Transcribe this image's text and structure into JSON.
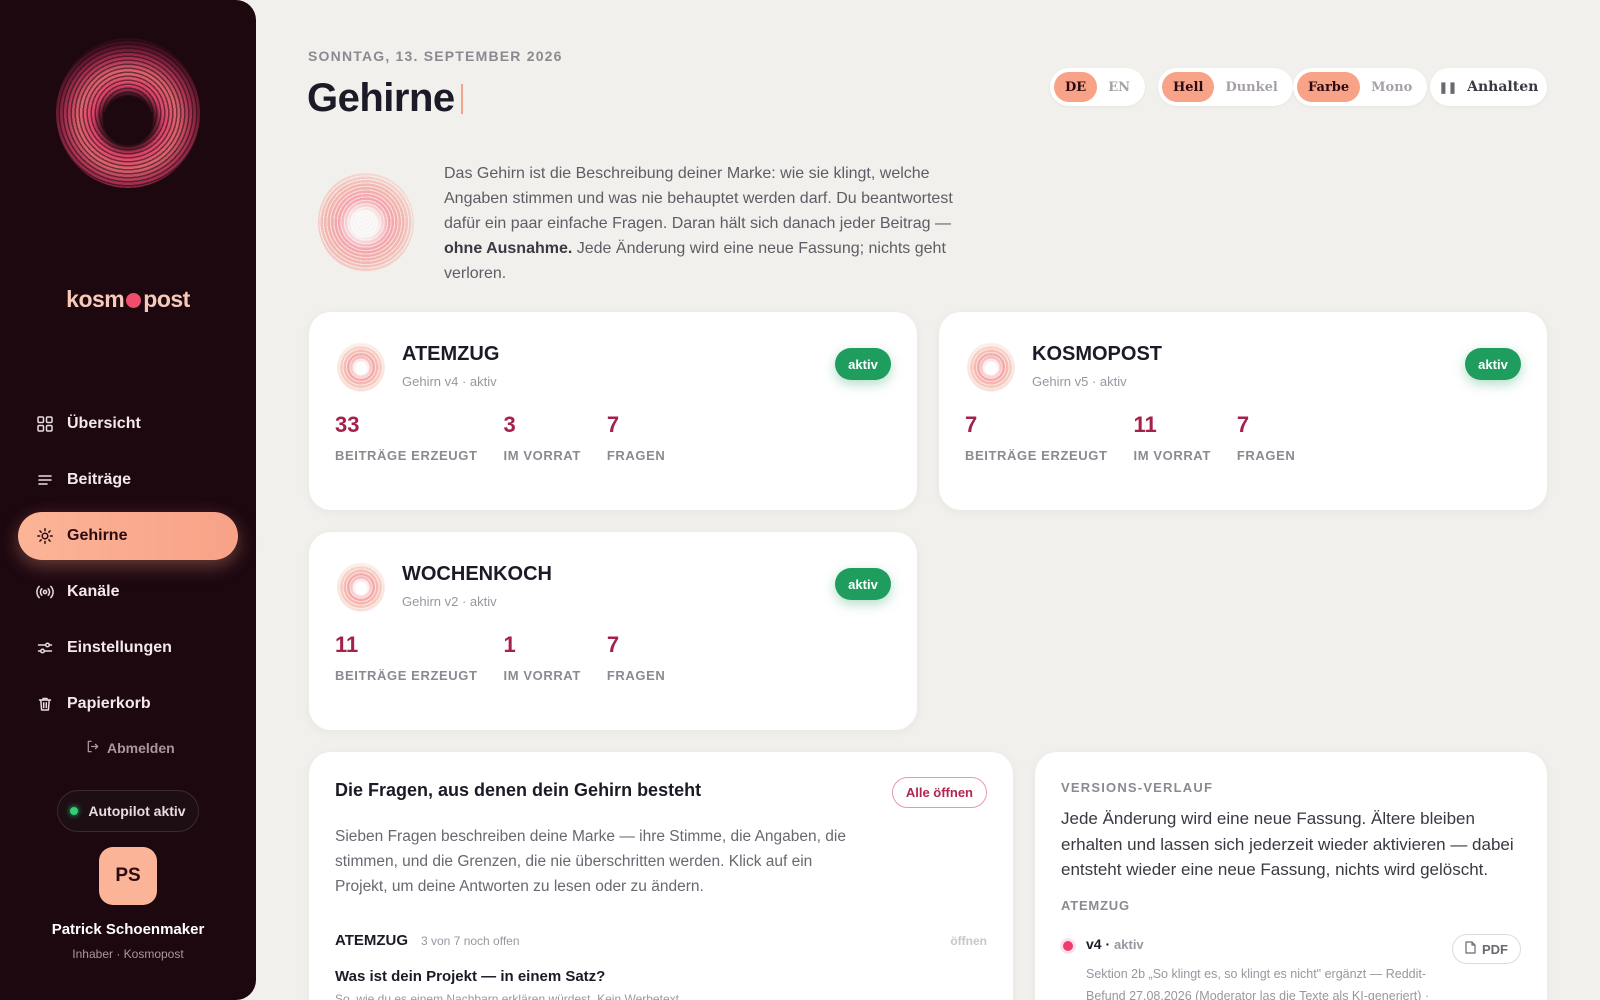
{
  "sidebar": {
    "brand_prefix": "kosm",
    "brand_suffix": "post",
    "nav": [
      {
        "label": "Übersicht",
        "icon": "grid-icon"
      },
      {
        "label": "Beiträge",
        "icon": "lines-icon"
      },
      {
        "label": "Gehirne",
        "icon": "sun-icon",
        "active": true
      },
      {
        "label": "Kanäle",
        "icon": "broadcast-icon"
      },
      {
        "label": "Einstellungen",
        "icon": "sliders-icon"
      },
      {
        "label": "Papierkorb",
        "icon": "trash-icon"
      }
    ],
    "logout": "Abmelden",
    "autopilot": "Autopilot aktiv",
    "avatar_initials": "PS",
    "user_name": "Patrick Schoenmaker",
    "user_role": "Inhaber · Kosmopost"
  },
  "header": {
    "date": "SONNTAG, 13. SEPTEMBER 2026",
    "title": "Gehirne",
    "lang": {
      "a": "DE",
      "b": "EN",
      "selected": "DE"
    },
    "theme": {
      "a": "Hell",
      "b": "Dunkel",
      "selected": "Hell"
    },
    "color": {
      "a": "Farbe",
      "b": "Mono",
      "selected": "Farbe"
    },
    "pause": "Anhalten"
  },
  "intro": {
    "text_before": "Das Gehirn ist die Beschreibung deiner Marke: wie sie klingt, welche Angaben stimmen und was nie behauptet werden darf. Du beantwortest dafür ein paar einfache Fragen. Daran hält sich danach jeder Beitrag — ",
    "bold": "ohne Ausnahme.",
    "text_after": " Jede Änderung wird eine neue Fassung; nichts geht verloren."
  },
  "brains": [
    {
      "name": "ATEMZUG",
      "version": "Gehirn v4 · aktiv",
      "badge": "aktiv",
      "stats": [
        {
          "value": "33",
          "label": "BEITRÄGE ERZEUGT"
        },
        {
          "value": "3",
          "label": "IM VORRAT"
        },
        {
          "value": "7",
          "label": "FRAGEN"
        }
      ]
    },
    {
      "name": "KOSMOPOST",
      "version": "Gehirn v5 · aktiv",
      "badge": "aktiv",
      "stats": [
        {
          "value": "7",
          "label": "BEITRÄGE ERZEUGT"
        },
        {
          "value": "11",
          "label": "IM VORRAT"
        },
        {
          "value": "7",
          "label": "FRAGEN"
        }
      ]
    },
    {
      "name": "WOCHENKOCH",
      "version": "Gehirn v2 · aktiv",
      "badge": "aktiv",
      "stats": [
        {
          "value": "11",
          "label": "BEITRÄGE ERZEUGT"
        },
        {
          "value": "1",
          "label": "IM VORRAT"
        },
        {
          "value": "7",
          "label": "FRAGEN"
        }
      ]
    }
  ],
  "questions": {
    "title": "Die Fragen, aus denen dein Gehirn besteht",
    "open_all": "Alle öffnen",
    "text": "Sieben Fragen beschreiben deine Marke — ihre Stimme, die Angaben, die stimmen, und die Grenzen, die nie überschritten werden. Klick auf ein Projekt, um deine Antworten zu lesen oder zu ändern.",
    "project": "ATEMZUG",
    "project_meta": "3 von 7 noch offen",
    "project_open": "öffnen",
    "first_question": "Was ist dein Projekt — in einem Satz?",
    "first_question_sub": "So, wie du es einem Nachbarn erklären würdest. Kein Werbetext."
  },
  "versions": {
    "label": "VERSIONS-VERLAUF",
    "text": "Jede Änderung wird eine neue Fassung. Ältere bleiben erhalten und lassen sich jederzeit wieder aktivieren — dabei entsteht wieder eine neue Fassung, nichts wird gelöscht.",
    "project": "ATEMZUG",
    "entry_version": "v4",
    "entry_status": "aktiv",
    "pdf": "PDF",
    "entry_note": "Sektion 2b „So klingt es, so klingt es nicht\" ergänzt — Reddit-Befund 27.08.2026 (Moderator las die Texte als KI-generiert) ·"
  },
  "colors": {
    "accent": "#f8a288",
    "sidebar": "#1d0810",
    "stat": "#a6214a",
    "active_badge": "#1f9d5e"
  }
}
